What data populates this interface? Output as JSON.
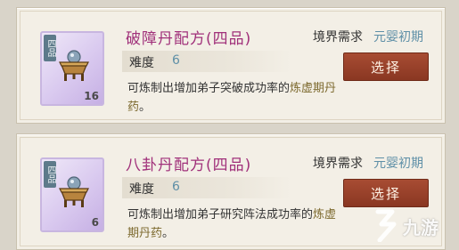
{
  "recipes": [
    {
      "grade_tag": "四品",
      "count": "16",
      "title": "破障丹配方(四品)",
      "req_label": "境界需求",
      "req_value": "元婴初期",
      "difficulty_label": "难度",
      "difficulty_value": "6",
      "desc_main": "可炼制出增加弟子突破成功率的",
      "desc_highlight": "炼虚期丹药",
      "desc_end": "。",
      "button_label": "选择"
    },
    {
      "grade_tag": "四品",
      "count": "6",
      "title": "八卦丹配方(四品)",
      "req_label": "境界需求",
      "req_value": "元婴初期",
      "difficulty_label": "难度",
      "difficulty_value": "6",
      "desc_main": "可炼制出增加弟子研究阵法成功率的",
      "desc_highlight": "炼虚期丹药",
      "desc_end": "。",
      "button_label": "选择"
    }
  ],
  "watermark": {
    "text": "九游"
  },
  "colors": {
    "title": "#a0307a",
    "value_blue": "#5e8fa7",
    "button": "#9a4129",
    "item_bg": "#d9c9ef"
  }
}
